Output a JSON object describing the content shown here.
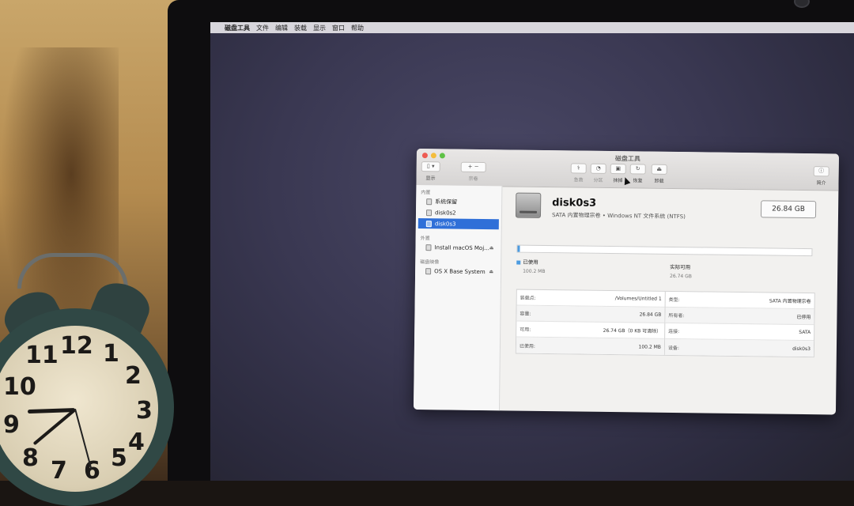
{
  "menubar": {
    "app_name": "磁盘工具",
    "items": [
      "文件",
      "编辑",
      "装载",
      "显示",
      "窗口",
      "帮助"
    ]
  },
  "window": {
    "title": "磁盘工具",
    "toolbar": {
      "view_label": "显示",
      "volume_label": "宗卷",
      "volume_button": "+  −",
      "first_aid_label": "急救",
      "partition_label": "分区",
      "erase_label": "抹掉",
      "restore_label": "恢复",
      "unmount_label": "卸载",
      "info_label": "简介"
    },
    "sidebar": {
      "internal_header": "内置",
      "internal_items": [
        "系统保留",
        "disk0s2",
        "disk0s3"
      ],
      "external_header": "外置",
      "external_items": [
        "Install macOS Moj..."
      ],
      "image_header": "磁盘映像",
      "image_items": [
        "OS X Base System"
      ]
    },
    "detail": {
      "name": "disk0s3",
      "description": "SATA 内置物理宗卷 • Windows NT 文件系统 (NTFS)",
      "size": "26.84 GB",
      "used_label": "已使用",
      "used_value": "100.2 MB",
      "used_fraction": 0.004,
      "available_label": "实际可用",
      "available_value": "26.74 GB",
      "info_left": [
        {
          "k": "装载点:",
          "v": "/Volumes/Untitled 1"
        },
        {
          "k": "容量:",
          "v": "26.84 GB"
        },
        {
          "k": "可用:",
          "v": "26.74 GB（0 KB 可清除）"
        },
        {
          "k": "已使用:",
          "v": "100.2 MB"
        }
      ],
      "info_right": [
        {
          "k": "类型:",
          "v": "SATA 内置物理宗卷"
        },
        {
          "k": "所有者:",
          "v": "已停用"
        },
        {
          "k": "连接:",
          "v": "SATA"
        },
        {
          "k": "设备:",
          "v": "disk0s3"
        }
      ]
    }
  },
  "clock": {
    "numerals": [
      "11",
      "12",
      "1",
      "2",
      "10",
      "3",
      "9",
      "4",
      "8",
      "7",
      "6",
      "5"
    ]
  },
  "colors": {
    "selection": "#2f6fd8",
    "used_bar": "#4c9be0",
    "screen": "#3a3852"
  }
}
